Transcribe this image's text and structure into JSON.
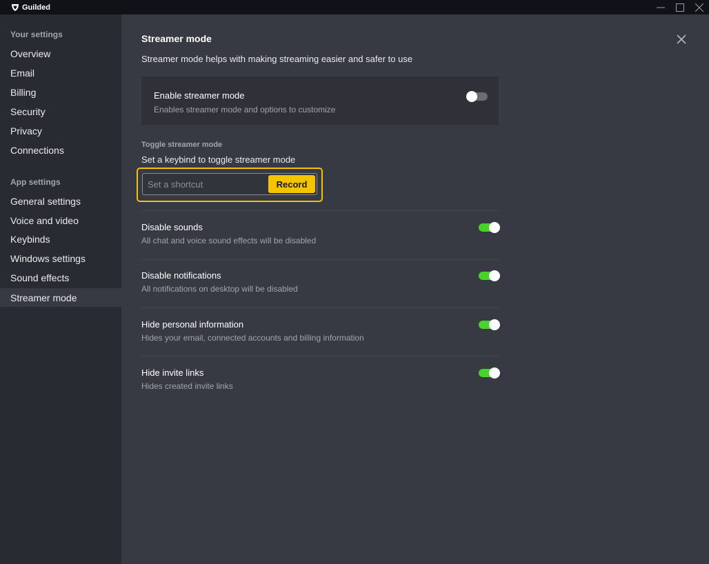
{
  "app": {
    "title": "Guilded"
  },
  "window_controls": [
    "minimize-icon",
    "maximize-icon",
    "close-icon"
  ],
  "sidebar": {
    "your_settings": {
      "header": "Your settings",
      "items": [
        "Overview",
        "Email",
        "Billing",
        "Security",
        "Privacy",
        "Connections"
      ]
    },
    "app_settings": {
      "header": "App settings",
      "items": [
        "General settings",
        "Voice and video",
        "Keybinds",
        "Windows settings",
        "Sound effects",
        "Streamer mode"
      ]
    },
    "active_item": "Streamer mode"
  },
  "main": {
    "title": "Streamer mode",
    "subtitle": "Streamer mode helps with making streaming easier and safer to use",
    "enable": {
      "title": "Enable streamer mode",
      "description": "Enables streamer mode and options to customize",
      "enabled": false
    },
    "keybind": {
      "header": "Toggle streamer mode",
      "description": "Set a keybind to toggle streamer mode",
      "placeholder": "Set a shortcut",
      "value": "",
      "record_label": "Record"
    },
    "options": [
      {
        "title": "Disable sounds",
        "description": "All chat and voice sound effects will be disabled",
        "enabled": true
      },
      {
        "title": "Disable notifications",
        "description": "All notifications on desktop will be disabled",
        "enabled": true
      },
      {
        "title": "Hide personal information",
        "description": "Hides your email, connected accounts and billing information",
        "enabled": true
      },
      {
        "title": "Hide invite links",
        "description": "Hides created invite links",
        "enabled": true
      }
    ]
  },
  "colors": {
    "accent": "#f5c400",
    "toggle_on": "#48d32a",
    "toggle_off": "#6b6d76",
    "sidebar_bg": "#292b32",
    "main_bg": "#373943",
    "titlebar_bg": "#111217"
  }
}
